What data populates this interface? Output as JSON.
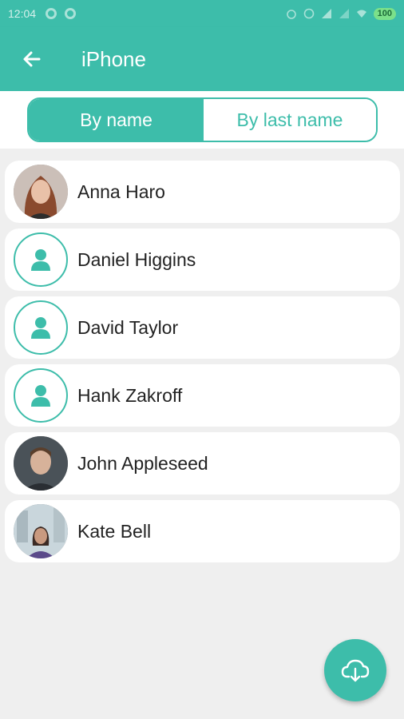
{
  "status_bar": {
    "time": "12:04",
    "battery": "100"
  },
  "app_bar": {
    "title": "iPhone",
    "back_icon": "arrow-left-icon"
  },
  "segment": {
    "options": [
      {
        "label": "By name",
        "selected": true
      },
      {
        "label": "By last name",
        "selected": false
      }
    ]
  },
  "contacts": [
    {
      "name": "Anna Haro",
      "avatar": "photo"
    },
    {
      "name": "Daniel Higgins",
      "avatar": "person-placeholder-icon"
    },
    {
      "name": "David Taylor",
      "avatar": "person-placeholder-icon"
    },
    {
      "name": "Hank Zakroff",
      "avatar": "person-placeholder-icon"
    },
    {
      "name": "John Appleseed",
      "avatar": "photo"
    },
    {
      "name": "Kate Bell",
      "avatar": "photo"
    }
  ],
  "fab": {
    "icon": "cloud-download-icon"
  },
  "colors": {
    "accent": "#3dbdaa",
    "background": "#efefef",
    "card": "#ffffff",
    "text": "#222222"
  }
}
